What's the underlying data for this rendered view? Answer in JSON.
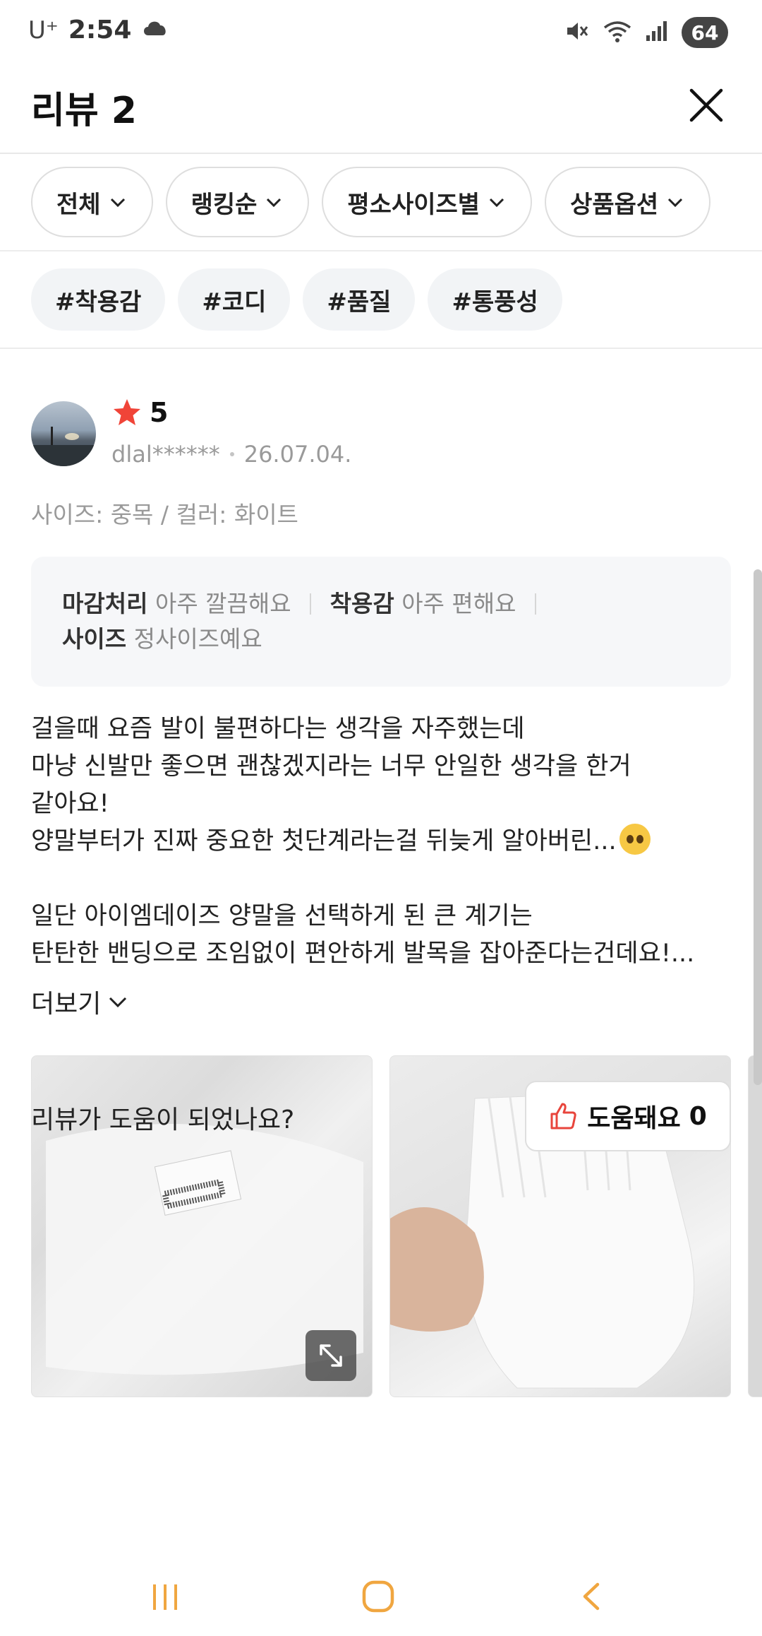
{
  "status_bar": {
    "carrier": "U⁺",
    "time": "2:54",
    "battery": "64",
    "icons": [
      "cloud-icon",
      "mute-icon",
      "wifi-icon",
      "signal-icon"
    ]
  },
  "header": {
    "title": "리뷰 2",
    "close_icon": "close-icon"
  },
  "filters": [
    "전체",
    "랭킹순",
    "평소사이즈별",
    "상품옵션"
  ],
  "hashtags": [
    "#착용감",
    "#코디",
    "#품질",
    "#통풍성"
  ],
  "review": {
    "rating": "5",
    "user": "dlal******",
    "date": "26.07.04.",
    "option": "사이즈: 중목 / 컬러: 화이트",
    "summary": [
      {
        "key": "마감처리",
        "value": "아주 깔끔해요"
      },
      {
        "key": "착용감",
        "value": "아주 편해요"
      },
      {
        "key": "사이즈",
        "value": "정사이즈예요"
      }
    ],
    "text_lines": [
      "걸을때 요즘 발이 불편하다는 생각을 자주했는데",
      "마냥 신발만 좋으면 괜찮겠지라는 너무 안일한 생각을 한거",
      "같아요!",
      "양말부터가 진짜 중요한 첫단계라는걸 뒤늦게 알아버린...",
      "일단 아이엠데이즈 양말을 선택하게 된 큰 계기는",
      "탄탄한 밴딩으로 조임없이 편안하게 발목을 잡아준다는건데요!..."
    ],
    "more_label": "더보기",
    "helpful_question": "리뷰가 도움이 되었나요?",
    "helpful_label": "도움돼요",
    "helpful_count": "0"
  },
  "colors": {
    "star": "#f04438",
    "thumb": "#e8453c",
    "nav": "#f0a640"
  }
}
